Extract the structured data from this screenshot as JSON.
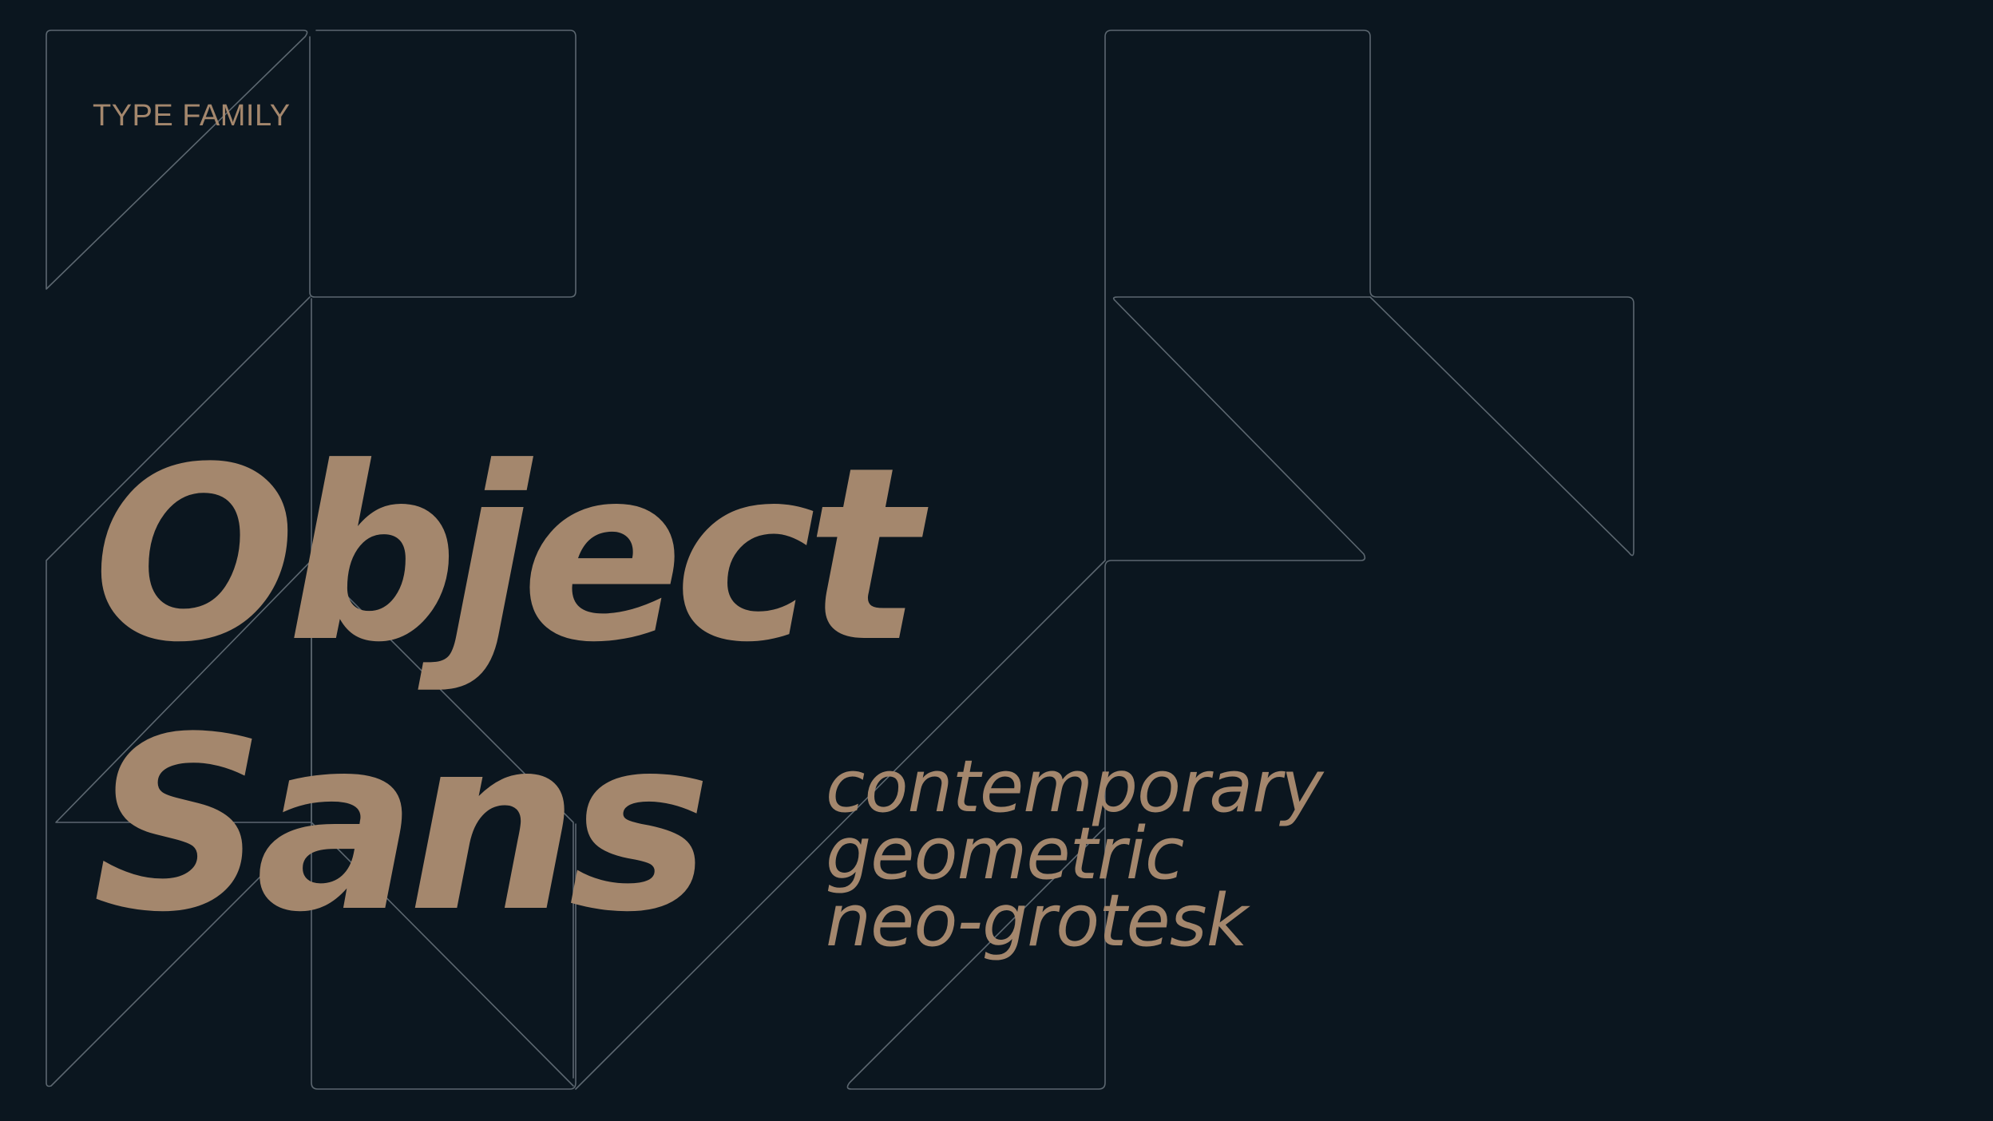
{
  "eyebrow": "TYPE FAMILY",
  "title": {
    "line1": "Object",
    "line2": "Sans"
  },
  "descriptors": [
    "contemporary",
    "geometric",
    "neo-grotesk"
  ],
  "colors": {
    "background": "#0b161f",
    "accent": "#a4876d",
    "outline": "#5c6770"
  }
}
